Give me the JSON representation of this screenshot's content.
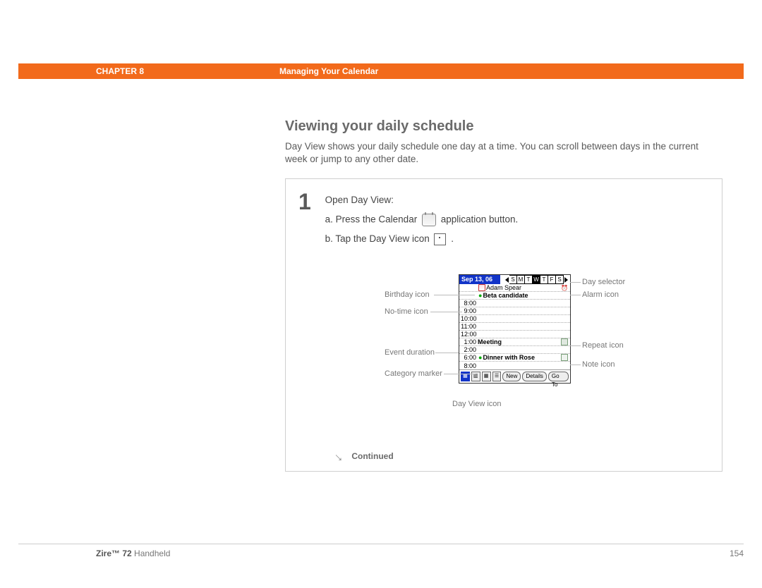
{
  "header": {
    "chapter": "CHAPTER 8",
    "title": "Managing Your Calendar"
  },
  "section": {
    "title": "Viewing your daily schedule",
    "intro": "Day View shows your daily schedule one day at a time. You can scroll between days in the current week or jump to any other date."
  },
  "step": {
    "number": "1",
    "lead": "Open Day View:",
    "a_prefix": "a.  Press the Calendar ",
    "a_suffix": " application button.",
    "b_prefix": "b.  Tap the Day View icon ",
    "b_suffix": ".",
    "continued": "Continued"
  },
  "palm": {
    "date": "Sep 13, 06",
    "days": [
      "S",
      "M",
      "T",
      "W",
      "T",
      "F",
      "S"
    ],
    "selected_day_index": 3,
    "rows": [
      {
        "time": "",
        "text": "Adam Spear",
        "birthday": true,
        "alarm": true
      },
      {
        "time": "",
        "text": "Beta candidate",
        "greendot": true
      },
      {
        "time": "8:00",
        "text": ""
      },
      {
        "time": "9:00",
        "text": ""
      },
      {
        "time": "10:00",
        "text": ""
      },
      {
        "time": "11:00",
        "text": ""
      },
      {
        "time": "12:00",
        "text": ""
      },
      {
        "time": "1:00",
        "text": "Meeting",
        "repeat": true
      },
      {
        "time": "2:00",
        "text": ""
      },
      {
        "time": "6:00",
        "text": "Dinner with Rose",
        "greendot": true,
        "note": true
      },
      {
        "time": "8:00",
        "text": ""
      }
    ],
    "buttons": {
      "new": "New",
      "details": "Details",
      "goto": "Go To"
    }
  },
  "annotations": {
    "left": {
      "birthday": "Birthday icon",
      "notime": "No-time icon",
      "duration": "Event duration",
      "category": "Category marker",
      "dayview": "Day View icon"
    },
    "right": {
      "dayselector": "Day selector",
      "alarm": "Alarm icon",
      "repeat": "Repeat icon",
      "note": "Note icon"
    }
  },
  "footer": {
    "product_bold": "Zire™ 72",
    "product_rest": " Handheld",
    "page": "154"
  }
}
